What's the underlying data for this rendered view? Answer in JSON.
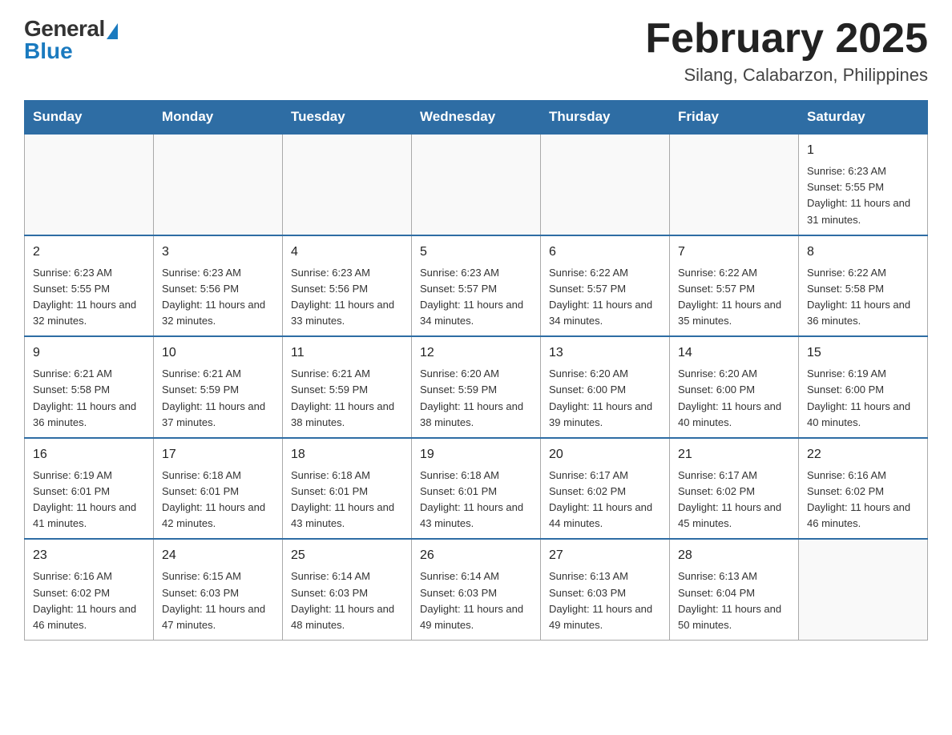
{
  "logo": {
    "general": "General",
    "blue": "Blue"
  },
  "header": {
    "title": "February 2025",
    "subtitle": "Silang, Calabarzon, Philippines"
  },
  "weekdays": [
    "Sunday",
    "Monday",
    "Tuesday",
    "Wednesday",
    "Thursday",
    "Friday",
    "Saturday"
  ],
  "weeks": [
    [
      {
        "day": "",
        "info": ""
      },
      {
        "day": "",
        "info": ""
      },
      {
        "day": "",
        "info": ""
      },
      {
        "day": "",
        "info": ""
      },
      {
        "day": "",
        "info": ""
      },
      {
        "day": "",
        "info": ""
      },
      {
        "day": "1",
        "info": "Sunrise: 6:23 AM\nSunset: 5:55 PM\nDaylight: 11 hours and 31 minutes."
      }
    ],
    [
      {
        "day": "2",
        "info": "Sunrise: 6:23 AM\nSunset: 5:55 PM\nDaylight: 11 hours and 32 minutes."
      },
      {
        "day": "3",
        "info": "Sunrise: 6:23 AM\nSunset: 5:56 PM\nDaylight: 11 hours and 32 minutes."
      },
      {
        "day": "4",
        "info": "Sunrise: 6:23 AM\nSunset: 5:56 PM\nDaylight: 11 hours and 33 minutes."
      },
      {
        "day": "5",
        "info": "Sunrise: 6:23 AM\nSunset: 5:57 PM\nDaylight: 11 hours and 34 minutes."
      },
      {
        "day": "6",
        "info": "Sunrise: 6:22 AM\nSunset: 5:57 PM\nDaylight: 11 hours and 34 minutes."
      },
      {
        "day": "7",
        "info": "Sunrise: 6:22 AM\nSunset: 5:57 PM\nDaylight: 11 hours and 35 minutes."
      },
      {
        "day": "8",
        "info": "Sunrise: 6:22 AM\nSunset: 5:58 PM\nDaylight: 11 hours and 36 minutes."
      }
    ],
    [
      {
        "day": "9",
        "info": "Sunrise: 6:21 AM\nSunset: 5:58 PM\nDaylight: 11 hours and 36 minutes."
      },
      {
        "day": "10",
        "info": "Sunrise: 6:21 AM\nSunset: 5:59 PM\nDaylight: 11 hours and 37 minutes."
      },
      {
        "day": "11",
        "info": "Sunrise: 6:21 AM\nSunset: 5:59 PM\nDaylight: 11 hours and 38 minutes."
      },
      {
        "day": "12",
        "info": "Sunrise: 6:20 AM\nSunset: 5:59 PM\nDaylight: 11 hours and 38 minutes."
      },
      {
        "day": "13",
        "info": "Sunrise: 6:20 AM\nSunset: 6:00 PM\nDaylight: 11 hours and 39 minutes."
      },
      {
        "day": "14",
        "info": "Sunrise: 6:20 AM\nSunset: 6:00 PM\nDaylight: 11 hours and 40 minutes."
      },
      {
        "day": "15",
        "info": "Sunrise: 6:19 AM\nSunset: 6:00 PM\nDaylight: 11 hours and 40 minutes."
      }
    ],
    [
      {
        "day": "16",
        "info": "Sunrise: 6:19 AM\nSunset: 6:01 PM\nDaylight: 11 hours and 41 minutes."
      },
      {
        "day": "17",
        "info": "Sunrise: 6:18 AM\nSunset: 6:01 PM\nDaylight: 11 hours and 42 minutes."
      },
      {
        "day": "18",
        "info": "Sunrise: 6:18 AM\nSunset: 6:01 PM\nDaylight: 11 hours and 43 minutes."
      },
      {
        "day": "19",
        "info": "Sunrise: 6:18 AM\nSunset: 6:01 PM\nDaylight: 11 hours and 43 minutes."
      },
      {
        "day": "20",
        "info": "Sunrise: 6:17 AM\nSunset: 6:02 PM\nDaylight: 11 hours and 44 minutes."
      },
      {
        "day": "21",
        "info": "Sunrise: 6:17 AM\nSunset: 6:02 PM\nDaylight: 11 hours and 45 minutes."
      },
      {
        "day": "22",
        "info": "Sunrise: 6:16 AM\nSunset: 6:02 PM\nDaylight: 11 hours and 46 minutes."
      }
    ],
    [
      {
        "day": "23",
        "info": "Sunrise: 6:16 AM\nSunset: 6:02 PM\nDaylight: 11 hours and 46 minutes."
      },
      {
        "day": "24",
        "info": "Sunrise: 6:15 AM\nSunset: 6:03 PM\nDaylight: 11 hours and 47 minutes."
      },
      {
        "day": "25",
        "info": "Sunrise: 6:14 AM\nSunset: 6:03 PM\nDaylight: 11 hours and 48 minutes."
      },
      {
        "day": "26",
        "info": "Sunrise: 6:14 AM\nSunset: 6:03 PM\nDaylight: 11 hours and 49 minutes."
      },
      {
        "day": "27",
        "info": "Sunrise: 6:13 AM\nSunset: 6:03 PM\nDaylight: 11 hours and 49 minutes."
      },
      {
        "day": "28",
        "info": "Sunrise: 6:13 AM\nSunset: 6:04 PM\nDaylight: 11 hours and 50 minutes."
      },
      {
        "day": "",
        "info": ""
      }
    ]
  ]
}
